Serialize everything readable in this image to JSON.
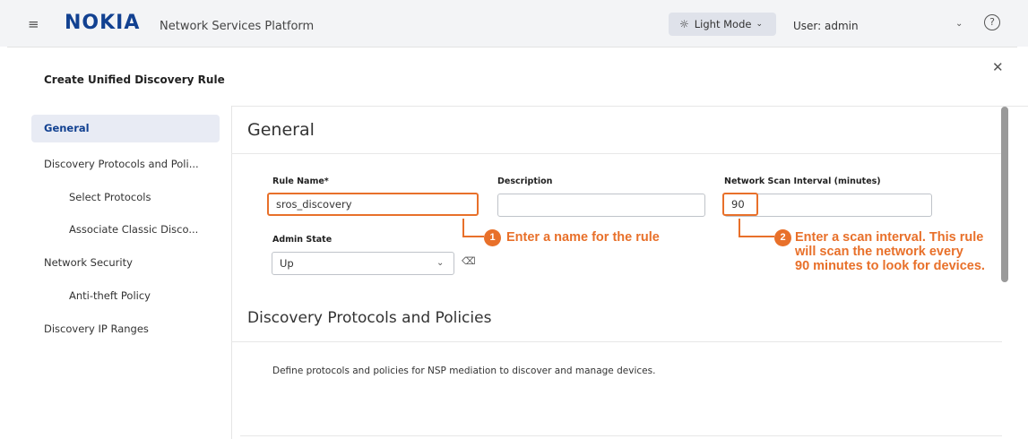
{
  "header": {
    "menu_icon": "hamburger-icon",
    "logo": "NOKIA",
    "app_title": "Network Services Platform",
    "mode_label": "Light Mode",
    "mode_icon": "sun-icon",
    "user_label": "User: admin",
    "help_icon": "help-icon"
  },
  "modal": {
    "title": "Create Unified Discovery Rule",
    "close_icon": "close-icon"
  },
  "sidebar": {
    "items": [
      {
        "label": "General",
        "active": true
      },
      {
        "label": "Discovery Protocols and Poli..."
      },
      {
        "label": "Select Protocols"
      },
      {
        "label": "Associate Classic Disco..."
      },
      {
        "label": "Network Security"
      },
      {
        "label": "Anti-theft Policy"
      },
      {
        "label": "Discovery IP Ranges"
      }
    ]
  },
  "general": {
    "heading": "General",
    "rule_name_label": "Rule Name*",
    "rule_name_value": "sros_discovery",
    "description_label": "Description",
    "description_value": "",
    "scan_interval_label": "Network Scan Interval (minutes)",
    "scan_interval_value": "90",
    "admin_state_label": "Admin State",
    "admin_state_value": "Up"
  },
  "discovery": {
    "heading": "Discovery Protocols and Policies",
    "description": "Define protocols and policies for NSP mediation to discover and manage devices."
  },
  "annotations": [
    {
      "number": "1",
      "line1": "Enter a name for the rule"
    },
    {
      "number": "2",
      "line1": "Enter a scan interval. This rule",
      "line2": "will scan the network every",
      "line3": "90 minutes to look for devices."
    }
  ],
  "colors": {
    "accent_orange": "#e8702a",
    "brand_blue": "#124191",
    "active_nav_bg": "#e8ebf4"
  }
}
